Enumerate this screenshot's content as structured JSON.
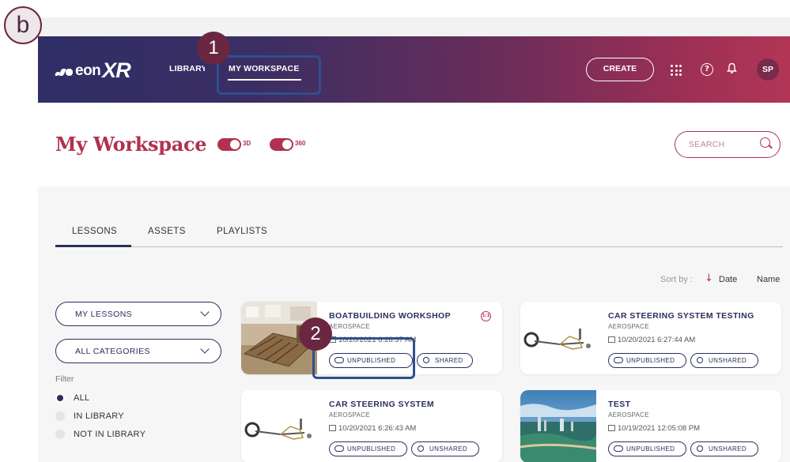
{
  "step_badges": {
    "b": "b",
    "one": "1",
    "two": "2"
  },
  "header": {
    "logo_text": "eon",
    "logo_xr": "XR",
    "nav": [
      {
        "label": "LIBRARY"
      },
      {
        "label": "MY WORKSPACE"
      }
    ],
    "create_label": "CREATE",
    "avatar_initials": "SP",
    "help_glyph": "?",
    "bell_glyph": "🔔",
    "gradient_colors": [
      "#2f2e66",
      "#6b2d5a",
      "#b23656"
    ]
  },
  "title_band": {
    "title": "My Workspace",
    "toggles": [
      {
        "label": "3D",
        "on": true
      },
      {
        "label": "360",
        "on": true
      }
    ],
    "search_placeholder": "SEARCH"
  },
  "tabs": [
    {
      "label": "LESSONS",
      "active": true
    },
    {
      "label": "ASSETS"
    },
    {
      "label": "PLAYLISTS"
    }
  ],
  "sort": {
    "label": "Sort by :",
    "arrow": "↓",
    "options": [
      "Date",
      "Name"
    ],
    "active": "Date"
  },
  "sidebar": {
    "dropdowns": [
      "MY LESSONS",
      "ALL CATEGORIES"
    ],
    "filter_title": "Filter",
    "filter_options": [
      {
        "label": "ALL",
        "checked": true
      },
      {
        "label": "IN LIBRARY"
      },
      {
        "label": "NOT IN LIBRARY"
      }
    ]
  },
  "cards": [
    {
      "name": "BOATBUILDING WORKSHOP",
      "category": "AEROSPACE",
      "date": "10/20/2021 6:28:37 AM",
      "status": "UNPUBLISHED",
      "share": "SHARED",
      "one_on_one": "1:1"
    },
    {
      "name": "CAR STEERING SYSTEM TESTING",
      "category": "AEROSPACE",
      "date": "10/20/2021 6:27:44 AM",
      "status": "UNPUBLISHED",
      "share": "UNSHARED"
    },
    {
      "name": "CAR STEERING SYSTEM",
      "category": "AEROSPACE",
      "date": "10/20/2021 6:26:43 AM",
      "status": "UNPUBLISHED",
      "share": "UNSHARED"
    },
    {
      "name": "TEST",
      "category": "AEROSPACE",
      "date": "10/19/2021 12:05:08 PM",
      "status": "UNPUBLISHED",
      "share": "UNSHARED"
    }
  ],
  "colors": {
    "accent": "#b1314f",
    "navy": "#2b2f5e",
    "highlight": "#2e4f8f",
    "badge": "#6b2742"
  }
}
